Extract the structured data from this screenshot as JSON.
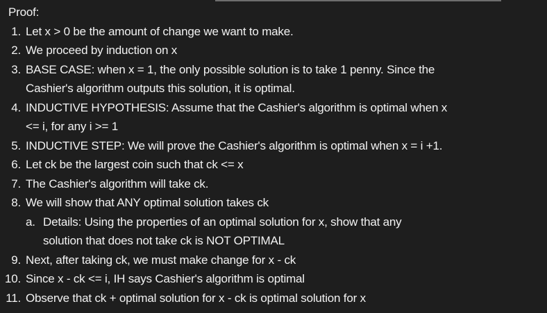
{
  "title": "Proof:",
  "items": [
    {
      "num": "1.",
      "lines": [
        "Let x > 0 be the amount of change we want to make."
      ]
    },
    {
      "num": "2.",
      "lines": [
        "We proceed by induction on x"
      ]
    },
    {
      "num": "3.",
      "lines": [
        "BASE CASE: when x = 1, the only possible solution is to take 1 penny.  Since the",
        "Cashier's algorithm outputs this solution, it is optimal."
      ]
    },
    {
      "num": "4.",
      "lines": [
        "INDUCTIVE HYPOTHESIS: Assume that the Cashier's algorithm is optimal when x",
        "<= i, for any i >= 1"
      ]
    },
    {
      "num": "5.",
      "lines": [
        "INDUCTIVE STEP: We will prove the Cashier's algorithm is optimal when x = i +1."
      ]
    },
    {
      "num": "6.",
      "lines": [
        "Let ck be the largest coin such that ck <= x"
      ]
    },
    {
      "num": "7.",
      "lines": [
        "The Cashier's algorithm will take ck."
      ]
    },
    {
      "num": "8.",
      "lines": [
        "We will show that ANY optimal solution takes ck"
      ]
    },
    {
      "num": "a.",
      "sub": true,
      "lines": [
        "Details: Using the properties of an optimal solution for x, show that any",
        "solution that does not take ck is NOT OPTIMAL"
      ]
    },
    {
      "num": "9.",
      "lines": [
        "Next, after taking ck, we must make change for x - ck"
      ]
    },
    {
      "num": "10.",
      "lines": [
        "Since x - ck <= i, IH says Cashier's algorithm is optimal"
      ]
    },
    {
      "num": "11.",
      "lines": [
        "Observe that ck + optimal solution for x - ck is optimal solution for x"
      ]
    }
  ]
}
